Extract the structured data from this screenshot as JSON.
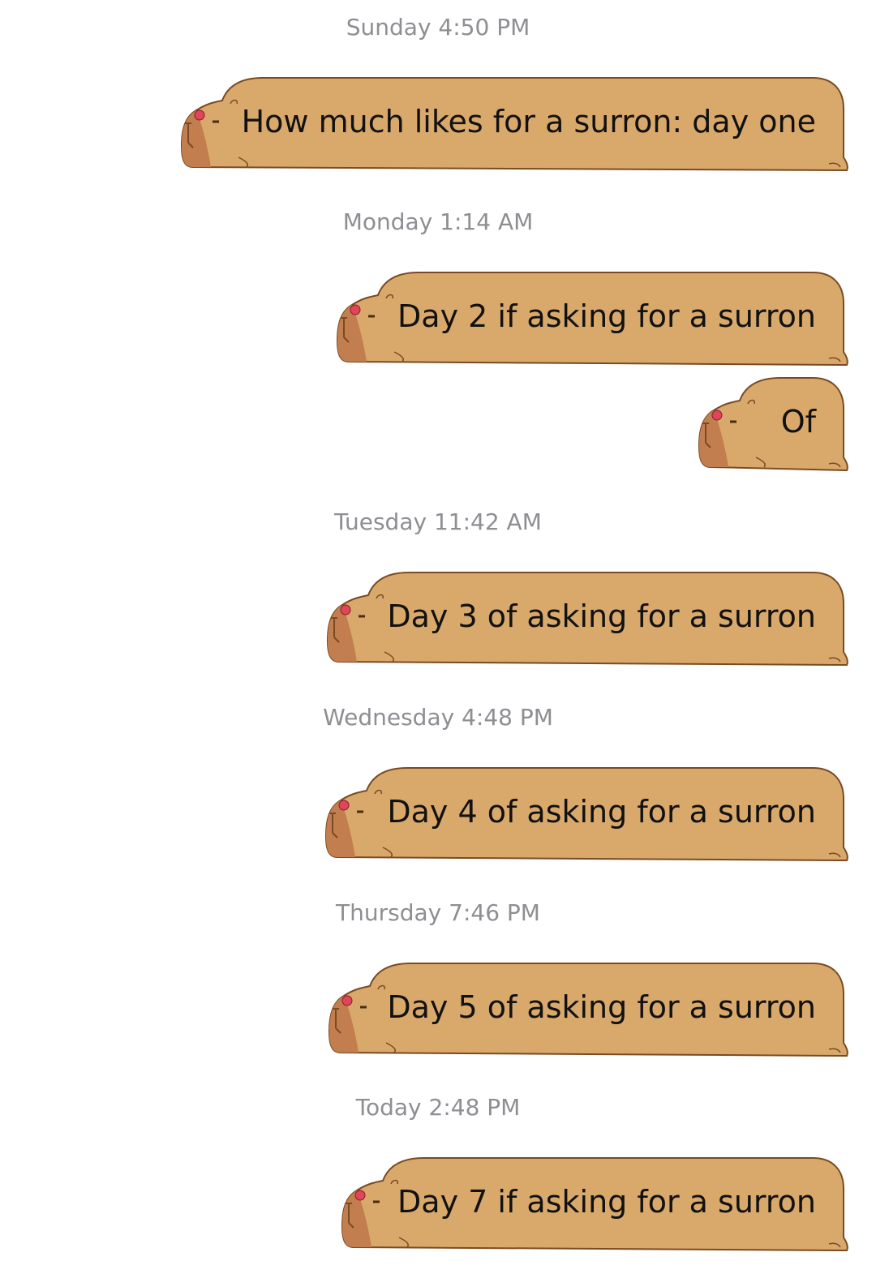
{
  "thread": [
    {
      "type": "timestamp",
      "text": "Sunday 4:50 PM"
    },
    {
      "type": "message",
      "text": "How much likes for a surron: day one"
    },
    {
      "type": "timestamp",
      "text": "Monday 1:14 AM"
    },
    {
      "type": "message",
      "text": "Day 2 if asking for a surron"
    },
    {
      "type": "message",
      "text": "Of"
    },
    {
      "type": "timestamp",
      "text": "Tuesday 11:42 AM"
    },
    {
      "type": "message",
      "text": "Day 3 of asking for a surron"
    },
    {
      "type": "timestamp",
      "text": "Wednesday 4:48 PM"
    },
    {
      "type": "message",
      "text": "Day 4 of asking for a surron"
    },
    {
      "type": "timestamp",
      "text": "Thursday 7:46 PM"
    },
    {
      "type": "message",
      "text": "Day 5 of asking for a surron"
    },
    {
      "type": "timestamp",
      "text": "Today 2:48 PM"
    },
    {
      "type": "message",
      "text": "Day 7 if asking for a surron"
    }
  ],
  "bubble_style": {
    "icon": "capybara-icon",
    "fill": "#d9a96c",
    "outline": "#7a4a22",
    "face_shade": "#c27e4f",
    "flower": "#e0465a"
  }
}
